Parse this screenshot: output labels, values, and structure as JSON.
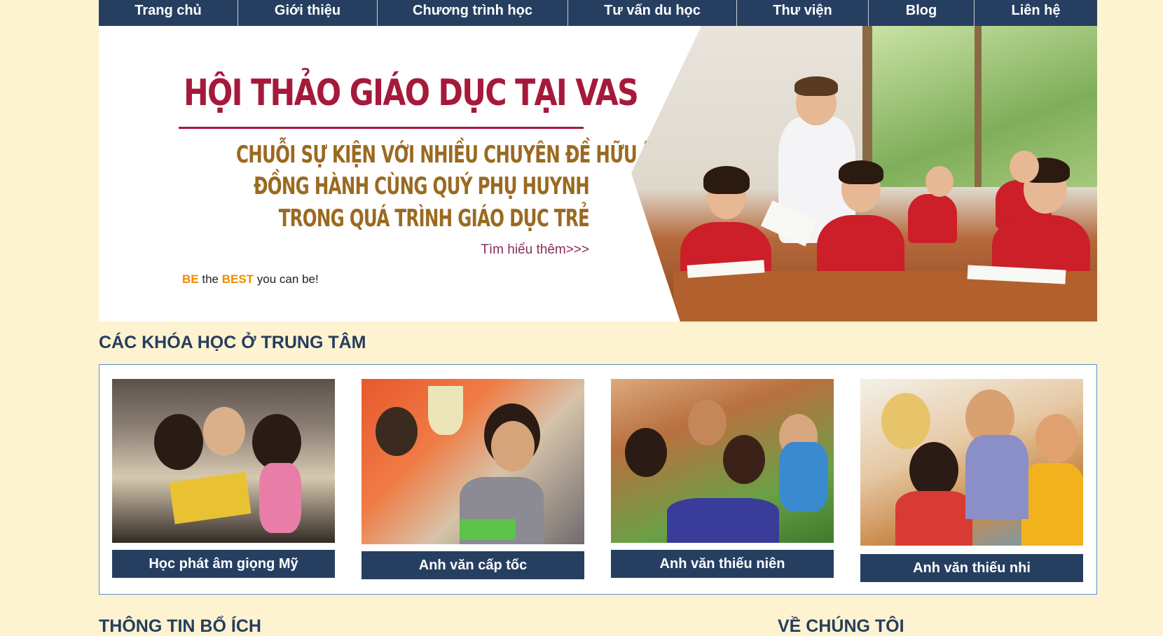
{
  "nav": {
    "items": [
      {
        "label": "Trang chủ"
      },
      {
        "label": "Giới thiệu"
      },
      {
        "label": "Chương trình học"
      },
      {
        "label": "Tư vấn du học"
      },
      {
        "label": "Thư viện"
      },
      {
        "label": "Blog"
      },
      {
        "label": "Liên hệ"
      }
    ]
  },
  "banner": {
    "headline": "HỘI THẢO GIÁO DỤC TẠI VAS",
    "sub_line_1": "CHUỖI SỰ KIỆN VỚI NHIỀU CHUYÊN ĐỀ HỮU ÍCH",
    "sub_line_2": "ĐỒNG HÀNH CÙNG QUÝ PHỤ HUYNH",
    "sub_line_3": "TRONG QUÁ TRÌNH GIÁO DỤC TRẺ",
    "learn_more": "Tìm hiểu thêm>>>",
    "motto": {
      "be": "BE",
      "the": " the ",
      "best": "BEST",
      "rest": " you can be!"
    }
  },
  "courses": {
    "title": "CÁC KHÓA HỌC Ở TRUNG TÂM",
    "items": [
      {
        "label": "Học phát âm giọng Mỹ"
      },
      {
        "label": "Anh văn cấp tốc"
      },
      {
        "label": "Anh văn thiếu niên"
      },
      {
        "label": "Anh văn thiếu nhi"
      }
    ]
  },
  "footer_sections": {
    "useful_info": "THÔNG TIN BỔ ÍCH",
    "about_us": "VỀ CHÚNG TÔI"
  },
  "colors": {
    "page_bg": "#fef3d0",
    "nav_bg": "#263f61",
    "headline_red": "#a5193a",
    "subtitle_gold": "#9a6a20",
    "section_title": "#253d5e"
  }
}
